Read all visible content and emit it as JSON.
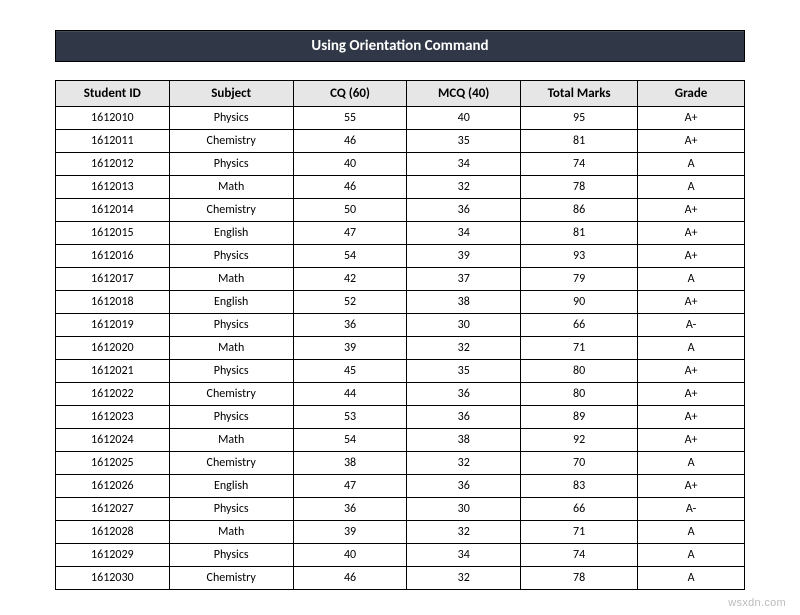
{
  "title": "Using Orientation Command",
  "watermark": "wsxdn.com",
  "headers": {
    "student_id": "Student ID",
    "subject": "Subject",
    "cq": "CQ  (60)",
    "mcq": "MCQ  (40)",
    "total": "Total Marks",
    "grade": "Grade"
  },
  "rows": [
    {
      "id": "1612010",
      "subject": "Physics",
      "cq": "55",
      "mcq": "40",
      "total": "95",
      "grade": "A+"
    },
    {
      "id": "1612011",
      "subject": "Chemistry",
      "cq": "46",
      "mcq": "35",
      "total": "81",
      "grade": "A+"
    },
    {
      "id": "1612012",
      "subject": "Physics",
      "cq": "40",
      "mcq": "34",
      "total": "74",
      "grade": "A"
    },
    {
      "id": "1612013",
      "subject": "Math",
      "cq": "46",
      "mcq": "32",
      "total": "78",
      "grade": "A"
    },
    {
      "id": "1612014",
      "subject": "Chemistry",
      "cq": "50",
      "mcq": "36",
      "total": "86",
      "grade": "A+"
    },
    {
      "id": "1612015",
      "subject": "English",
      "cq": "47",
      "mcq": "34",
      "total": "81",
      "grade": "A+"
    },
    {
      "id": "1612016",
      "subject": "Physics",
      "cq": "54",
      "mcq": "39",
      "total": "93",
      "grade": "A+"
    },
    {
      "id": "1612017",
      "subject": "Math",
      "cq": "42",
      "mcq": "37",
      "total": "79",
      "grade": "A"
    },
    {
      "id": "1612018",
      "subject": "English",
      "cq": "52",
      "mcq": "38",
      "total": "90",
      "grade": "A+"
    },
    {
      "id": "1612019",
      "subject": "Physics",
      "cq": "36",
      "mcq": "30",
      "total": "66",
      "grade": "A-"
    },
    {
      "id": "1612020",
      "subject": "Math",
      "cq": "39",
      "mcq": "32",
      "total": "71",
      "grade": "A"
    },
    {
      "id": "1612021",
      "subject": "Physics",
      "cq": "45",
      "mcq": "35",
      "total": "80",
      "grade": "A+"
    },
    {
      "id": "1612022",
      "subject": "Chemistry",
      "cq": "44",
      "mcq": "36",
      "total": "80",
      "grade": "A+"
    },
    {
      "id": "1612023",
      "subject": "Physics",
      "cq": "53",
      "mcq": "36",
      "total": "89",
      "grade": "A+"
    },
    {
      "id": "1612024",
      "subject": "Math",
      "cq": "54",
      "mcq": "38",
      "total": "92",
      "grade": "A+"
    },
    {
      "id": "1612025",
      "subject": "Chemistry",
      "cq": "38",
      "mcq": "32",
      "total": "70",
      "grade": "A"
    },
    {
      "id": "1612026",
      "subject": "English",
      "cq": "47",
      "mcq": "36",
      "total": "83",
      "grade": "A+"
    },
    {
      "id": "1612027",
      "subject": "Physics",
      "cq": "36",
      "mcq": "30",
      "total": "66",
      "grade": "A-"
    },
    {
      "id": "1612028",
      "subject": "Math",
      "cq": "39",
      "mcq": "32",
      "total": "71",
      "grade": "A"
    },
    {
      "id": "1612029",
      "subject": "Physics",
      "cq": "40",
      "mcq": "34",
      "total": "74",
      "grade": "A"
    },
    {
      "id": "1612030",
      "subject": "Chemistry",
      "cq": "46",
      "mcq": "32",
      "total": "78",
      "grade": "A"
    }
  ]
}
